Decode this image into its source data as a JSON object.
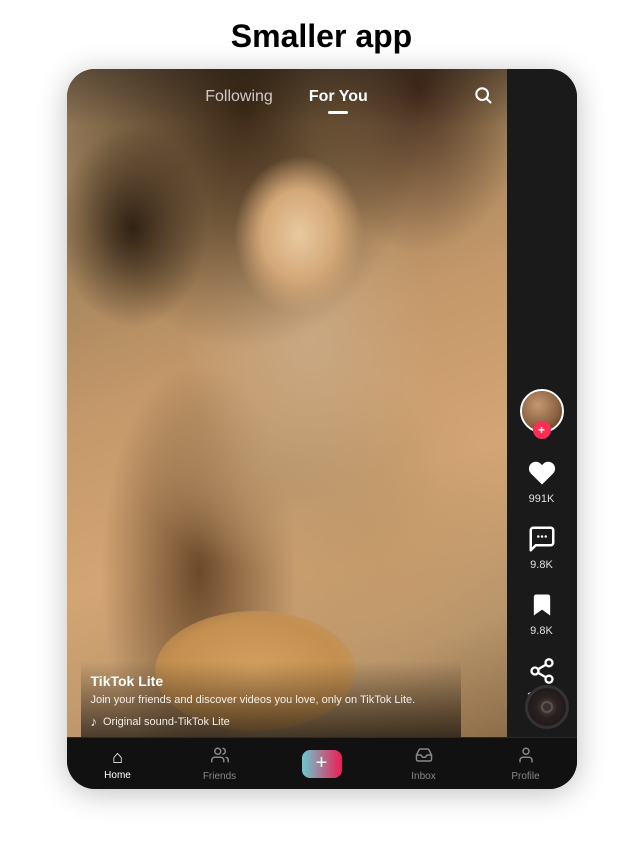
{
  "page": {
    "title": "Smaller app"
  },
  "nav_tabs": {
    "following": "Following",
    "for_you": "For You",
    "active": "for_you"
  },
  "video": {
    "username": "TikTok Lite",
    "description": "Join your friends and discover videos you love, only on TikTok Lite.",
    "sound": "Original sound-TikTok Lite"
  },
  "actions": {
    "likes": "991K",
    "comments": "9.8K",
    "bookmarks": "9.8K",
    "shares": "3.79K"
  },
  "bottom_nav": {
    "home": "Home",
    "friends": "Friends",
    "plus": "+",
    "inbox": "Inbox",
    "profile": "Profile"
  }
}
